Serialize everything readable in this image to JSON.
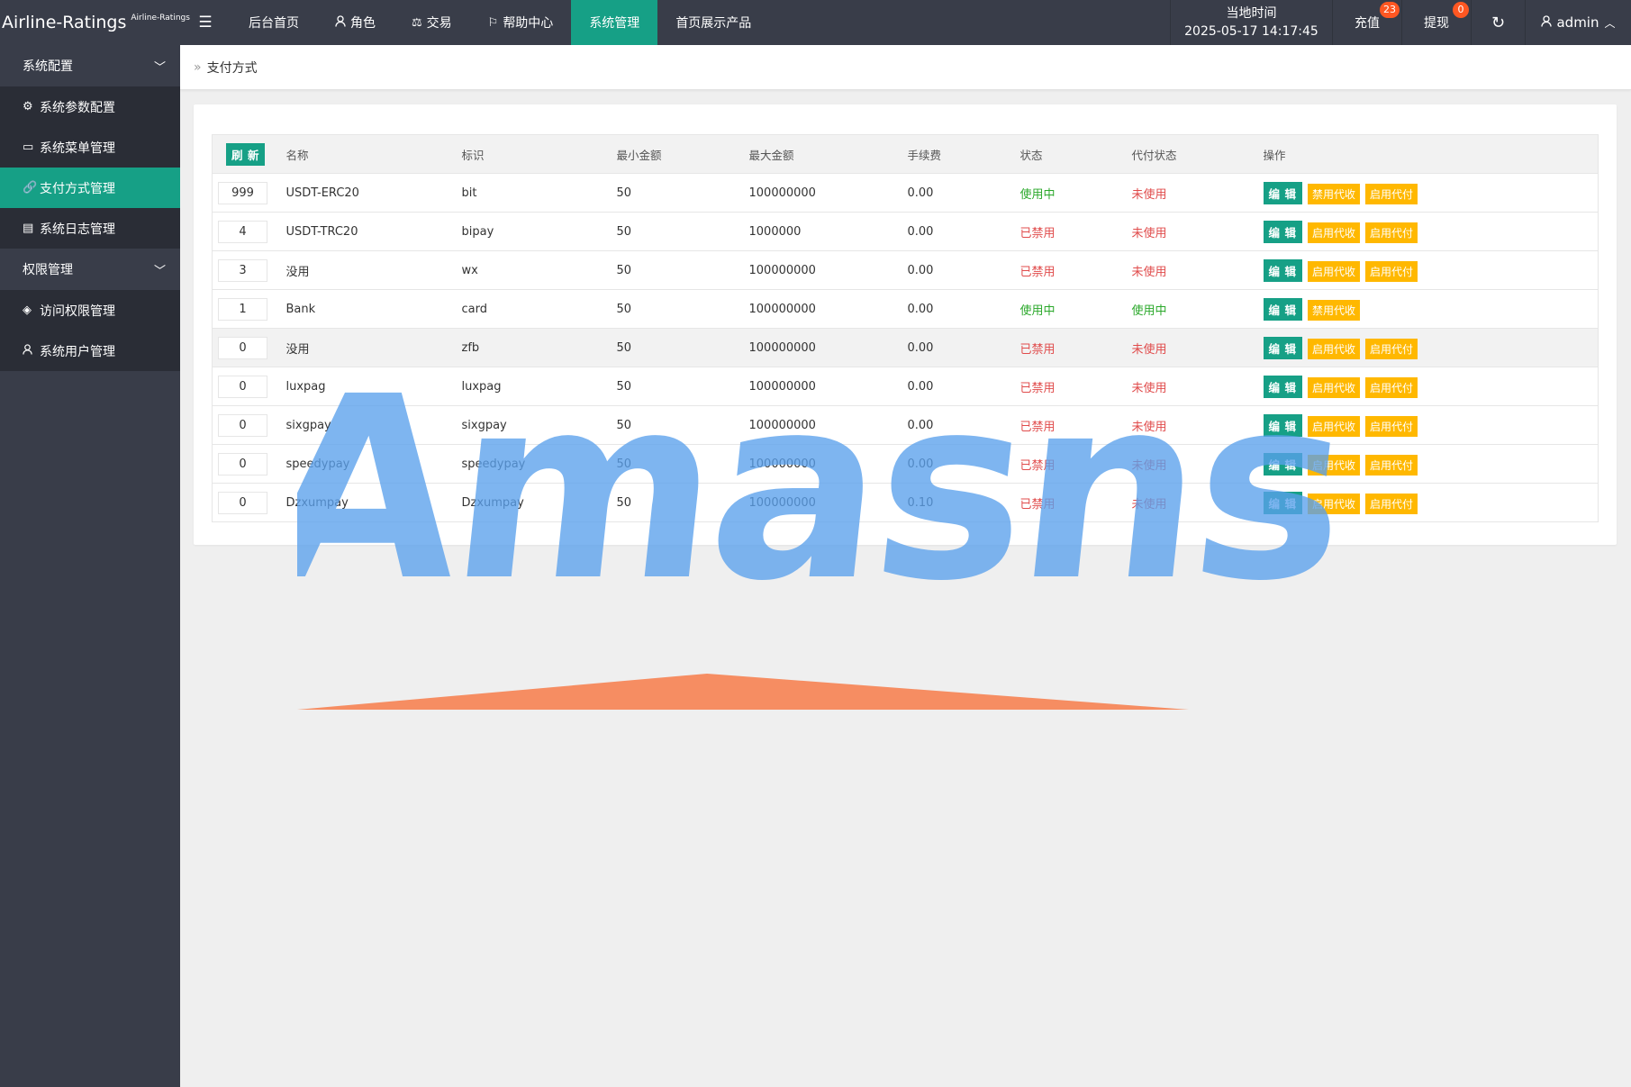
{
  "app": {
    "logo_main": "Airline-Ratings",
    "logo_sub": "Airline-Ratings"
  },
  "topnav": {
    "toggle_icon": "menu-icon",
    "items": [
      {
        "label": "后台首页",
        "icon": ""
      },
      {
        "label": "角色",
        "icon": "user-icon"
      },
      {
        "label": "交易",
        "icon": "scale-icon"
      },
      {
        "label": "帮助中心",
        "icon": "flag-icon"
      },
      {
        "label": "系统管理",
        "icon": "",
        "active": true
      },
      {
        "label": "首页展示产品",
        "icon": ""
      }
    ],
    "time_label": "当地时间",
    "time_value": "2025-05-17 14:17:45",
    "recharge_label": "充值",
    "recharge_badge": "23",
    "withdraw_label": "提现",
    "withdraw_badge": "0",
    "user_name": "admin"
  },
  "sidebar": {
    "groups": [
      {
        "label": "系统配置",
        "items": [
          {
            "label": "系统参数配置",
            "icon": "gear-icon"
          },
          {
            "label": "系统菜单管理",
            "icon": "window-icon"
          },
          {
            "label": "支付方式管理",
            "icon": "link-icon",
            "active": true
          },
          {
            "label": "系统日志管理",
            "icon": "document-icon"
          }
        ]
      },
      {
        "label": "权限管理",
        "items": [
          {
            "label": "访问权限管理",
            "icon": "shield-check-icon"
          },
          {
            "label": "系统用户管理",
            "icon": "user-icon"
          }
        ]
      }
    ]
  },
  "breadcrumb": {
    "current": "支付方式"
  },
  "table": {
    "refresh_label": "刷 新",
    "headers": [
      "名称",
      "标识",
      "最小金额",
      "最大金额",
      "手续费",
      "状态",
      "代付状态",
      "操作"
    ],
    "edit_label": "编 辑",
    "rows": [
      {
        "sort": "999",
        "name": "USDT-ERC20",
        "code": "bit",
        "min": "50",
        "max": "100000000",
        "fee": "0.00",
        "status": "使用中",
        "status_ok": true,
        "payout": "未使用",
        "payout_ok": false,
        "actions": [
          "禁用代收",
          "启用代付"
        ]
      },
      {
        "sort": "4",
        "name": "USDT-TRC20",
        "code": "bipay",
        "min": "50",
        "max": "1000000",
        "fee": "0.00",
        "status": "已禁用",
        "status_ok": false,
        "payout": "未使用",
        "payout_ok": false,
        "actions": [
          "启用代收",
          "启用代付"
        ]
      },
      {
        "sort": "3",
        "name": "没用",
        "code": "wx",
        "min": "50",
        "max": "100000000",
        "fee": "0.00",
        "status": "已禁用",
        "status_ok": false,
        "payout": "未使用",
        "payout_ok": false,
        "actions": [
          "启用代收",
          "启用代付"
        ]
      },
      {
        "sort": "1",
        "name": "Bank",
        "code": "card",
        "min": "50",
        "max": "100000000",
        "fee": "0.00",
        "status": "使用中",
        "status_ok": true,
        "payout": "使用中",
        "payout_ok": true,
        "actions": [
          "禁用代收"
        ]
      },
      {
        "sort": "0",
        "name": "没用",
        "code": "zfb",
        "min": "50",
        "max": "100000000",
        "fee": "0.00",
        "status": "已禁用",
        "status_ok": false,
        "payout": "未使用",
        "payout_ok": false,
        "actions": [
          "启用代收",
          "启用代付"
        ],
        "highlight": true
      },
      {
        "sort": "0",
        "name": "luxpag",
        "code": "luxpag",
        "min": "50",
        "max": "100000000",
        "fee": "0.00",
        "status": "已禁用",
        "status_ok": false,
        "payout": "未使用",
        "payout_ok": false,
        "actions": [
          "启用代收",
          "启用代付"
        ]
      },
      {
        "sort": "0",
        "name": "sixgpay",
        "code": "sixgpay",
        "min": "50",
        "max": "100000000",
        "fee": "0.00",
        "status": "已禁用",
        "status_ok": false,
        "payout": "未使用",
        "payout_ok": false,
        "actions": [
          "启用代收",
          "启用代付"
        ]
      },
      {
        "sort": "0",
        "name": "speedypay",
        "code": "speedypay",
        "min": "50",
        "max": "100000000",
        "fee": "0.00",
        "status": "已禁用",
        "status_ok": false,
        "payout": "未使用",
        "payout_ok": false,
        "actions": [
          "启用代收",
          "启用代付"
        ]
      },
      {
        "sort": "0",
        "name": "Dzxumpay",
        "code": "Dzxumpay",
        "min": "50",
        "max": "100000000",
        "fee": "0.10",
        "status": "已禁用",
        "status_ok": false,
        "payout": "未使用",
        "payout_ok": false,
        "actions": [
          "启用代收",
          "启用代付"
        ]
      }
    ]
  },
  "watermark": {
    "text": "Amasns"
  },
  "colors": {
    "accent": "#16a086",
    "dark": "#393d49",
    "warning": "#ffb800",
    "badge": "#ff5722",
    "ok": "#2aa82a",
    "bad": "#e04b4b"
  }
}
